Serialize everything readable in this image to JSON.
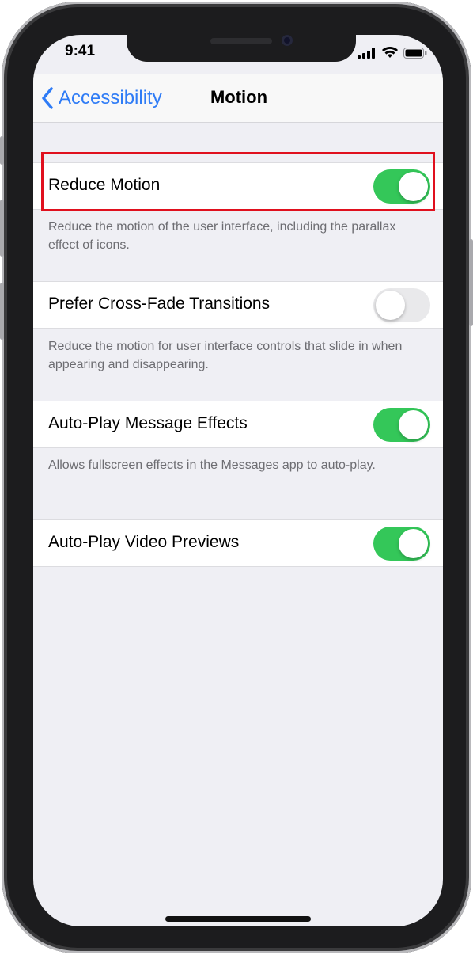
{
  "status_bar": {
    "time": "9:41"
  },
  "nav": {
    "back_label": "Accessibility",
    "title": "Motion"
  },
  "settings": [
    {
      "label": "Reduce Motion",
      "enabled": true,
      "footer": "Reduce the motion of the user interface, including the parallax effect of icons."
    },
    {
      "label": "Prefer Cross-Fade Transitions",
      "enabled": false,
      "footer": "Reduce the motion for user interface controls that slide in when appearing and disappearing."
    },
    {
      "label": "Auto-Play Message Effects",
      "enabled": true,
      "footer": "Allows fullscreen effects in the Messages app to auto-play."
    },
    {
      "label": "Auto-Play Video Previews",
      "enabled": true,
      "footer": ""
    }
  ],
  "colors": {
    "accent": "#2f7cf6",
    "toggle_on": "#34c759",
    "toggle_off": "#e9e9eb",
    "highlight": "#e0101e",
    "background": "#efeff4"
  },
  "icons": {
    "back": "chevron-left-icon",
    "signal": "cellular-signal-icon",
    "wifi": "wifi-icon",
    "battery": "battery-icon"
  }
}
